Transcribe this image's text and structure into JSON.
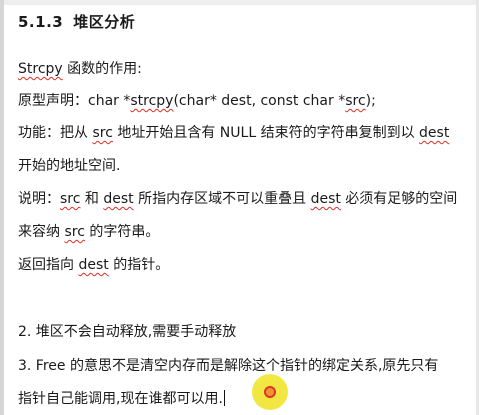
{
  "heading": {
    "number": "5.1.3",
    "title": "堆区分析"
  },
  "lines": {
    "l1": {
      "a": "Strcpy",
      "b": " 函数的作用:"
    },
    "l2": {
      "a": "原型声明：char *",
      "b": "strcpy",
      "c": "(char* dest, const char *",
      "d": "src",
      "e": ");"
    },
    "l3": {
      "a": "功能：把从 ",
      "b": "src",
      "c": " 地址开始且含有 NULL 结束符的字符串复制到以 ",
      "d": "dest"
    },
    "l4": {
      "a": "开始的地址空间."
    },
    "l5": {
      "a": "说明：",
      "b": "src",
      "c": " 和 ",
      "d": "dest",
      "e": " 所指内存区域不可以重叠且 ",
      "f": "dest",
      "g": " 必须有足够的空间"
    },
    "l6": {
      "a": "来容纳 ",
      "b": "src",
      "c": " 的字符串。"
    },
    "l7": {
      "a": "返回指向 ",
      "b": "dest",
      "c": " 的指针。"
    },
    "l8": {
      "a": "2. 堆区不会自动释放,需要手动释放"
    },
    "l9": {
      "a": "3. Free 的意思不是清空内存而是解除这个指针的绑定关系,原先只有"
    },
    "l10": {
      "a": "指针自己能调用,现在谁都可以用."
    }
  },
  "colors": {
    "spell_underline": "#d93025",
    "cursor_marker": "#f1e633"
  }
}
